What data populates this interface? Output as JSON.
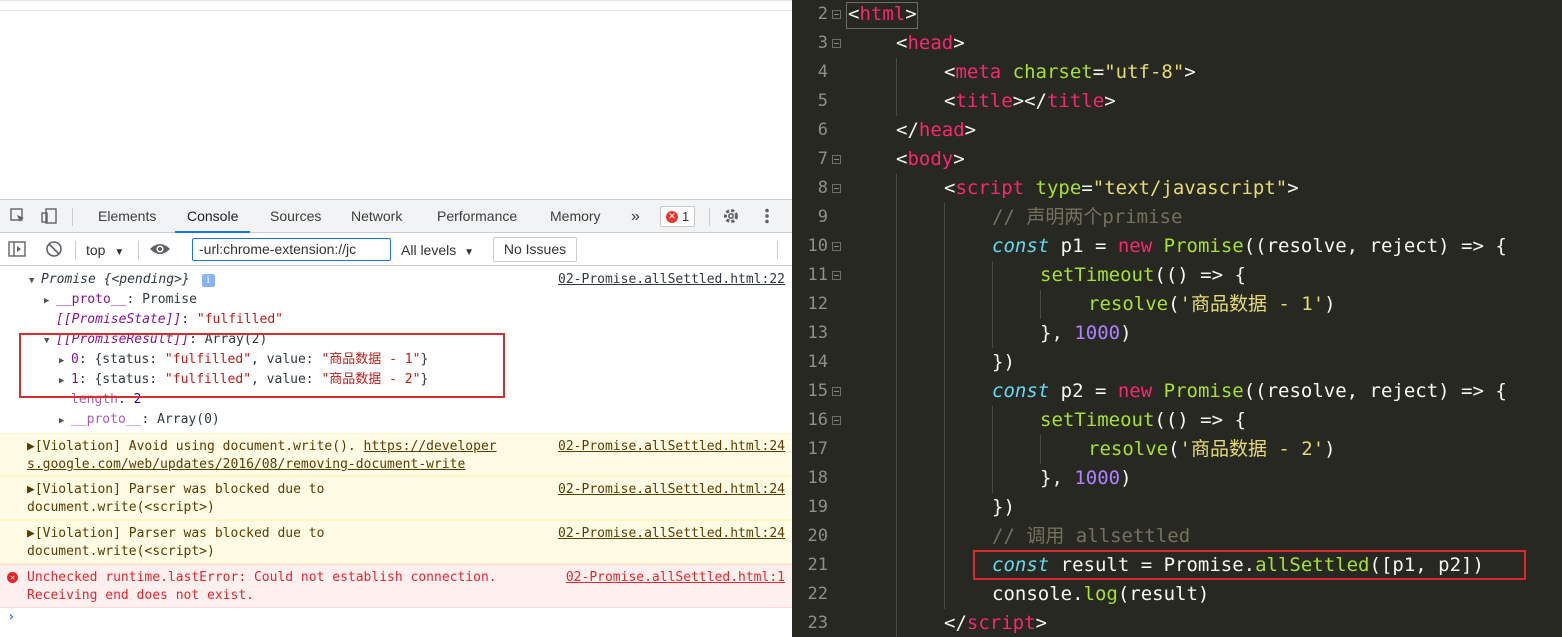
{
  "devtools": {
    "tabs": [
      "Elements",
      "Console",
      "Sources",
      "Network",
      "Performance",
      "Memory"
    ],
    "active_tab": "Console",
    "more_tabs": "»",
    "error_count": "1",
    "context": "top",
    "filter_value": "-url:chrome-extension://jc",
    "levels": "All levels",
    "no_issues": "No Issues"
  },
  "console": {
    "promise_header": "Promise",
    "promise_pending": "{<pending>}",
    "proto1_key": "__proto__",
    "proto1_val": ": Promise",
    "state_key": "[[PromiseState]]",
    "state_val": "\"fulfilled\"",
    "result_key": "[[PromiseResult]]",
    "result_val": ": Array(2)",
    "item0_idx": "0",
    "item0_pre": ": {status: ",
    "item0_status": "\"fulfilled\"",
    "item0_mid": ", value: ",
    "item0_value": "\"商品数据 - 1\"",
    "item0_end": "}",
    "item1_idx": "1",
    "item1_pre": ": {status: ",
    "item1_status": "\"fulfilled\"",
    "item1_mid": ", value: ",
    "item1_value": "\"商品数据 - 2\"",
    "item1_end": "}",
    "length_key": "length",
    "length_val": "2",
    "proto2_key": "__proto__",
    "proto2_val": ": Array(0)",
    "src_main": "02-Promise.allSettled.html:22",
    "warn1_text_a": "▶[Violation] Avoid using document.write(). ",
    "warn1_link_a": "https://developer",
    "warn1_link_b": "s.google.com/web/updates/2016/08/removing-document-write",
    "warn1_src": "02-Promise.allSettled.html:24",
    "warn2_text": "▶[Violation] Parser was blocked due to\ndocument.write(<script>)",
    "warn2_src": "02-Promise.allSettled.html:24",
    "warn3_text": "▶[Violation] Parser was blocked due to\ndocument.write(<script>)",
    "warn3_src": "02-Promise.allSettled.html:24",
    "err_text": "Unchecked runtime.lastError: Could not establish connection.\nReceiving end does not exist.",
    "err_src": "02-Promise.allSettled.html:1",
    "prompt": "›"
  },
  "editor": {
    "lines": [
      {
        "n": "2"
      },
      {
        "n": "3"
      },
      {
        "n": "4"
      },
      {
        "n": "5"
      },
      {
        "n": "6"
      },
      {
        "n": "7"
      },
      {
        "n": "8"
      },
      {
        "n": "9"
      },
      {
        "n": "10"
      },
      {
        "n": "11"
      },
      {
        "n": "12"
      },
      {
        "n": "13"
      },
      {
        "n": "14"
      },
      {
        "n": "15"
      },
      {
        "n": "16"
      },
      {
        "n": "17"
      },
      {
        "n": "18"
      },
      {
        "n": "19"
      },
      {
        "n": "20"
      },
      {
        "n": "21"
      },
      {
        "n": "22"
      },
      {
        "n": "23"
      }
    ],
    "tok": {
      "l2_tag": "html",
      "l3_tag": "head",
      "l4_tag": "meta",
      "l4_attr": "charset",
      "l4_val": "\"utf-8\"",
      "l5_tag": "title",
      "l5_ctag": "title",
      "l6_tag": "head",
      "l7_tag": "body",
      "l8_tag": "script",
      "l8_attr": "type",
      "l8_val": "\"text/javascript\"",
      "l9_com": "// 声明两个primise",
      "l10_kw": "const",
      "l10_a": " p1 = ",
      "l10_new": "new",
      "l10_cls": "Promise",
      "l10_b": "((resolve, reject) => {",
      "l11_fn": "setTimeout",
      "l11_b": "(() => {",
      "l12_fn": "resolve",
      "l12_a": "(",
      "l12_str": "'商品数据 - 1'",
      "l12_b": ")",
      "l13_a": "}, ",
      "l13_num": "1000",
      "l13_b": ")",
      "l14_a": "})",
      "l15_kw": "const",
      "l15_a": " p2 = ",
      "l15_new": "new",
      "l15_cls": "Promise",
      "l15_b": "((resolve, reject) => {",
      "l16_fn": "setTimeout",
      "l16_b": "(() => {",
      "l17_fn": "resolve",
      "l17_a": "(",
      "l17_str": "'商品数据 - 2'",
      "l17_b": ")",
      "l18_a": "}, ",
      "l18_num": "1000",
      "l18_b": ")",
      "l19_a": "})",
      "l20_com": "// 调用 allsettled",
      "l21_kw": "const",
      "l21_a": " result = Promise.",
      "l21_fn": "allSettled",
      "l21_b": "([p1, p2])",
      "l22_a": "console.",
      "l22_fn": "log",
      "l22_b": "(result)",
      "l23_tag": "script"
    }
  },
  "colors": {
    "editor_bg": "#272822",
    "highlight_border": "#e0262a",
    "devtools_accent": "#1a73e8"
  }
}
